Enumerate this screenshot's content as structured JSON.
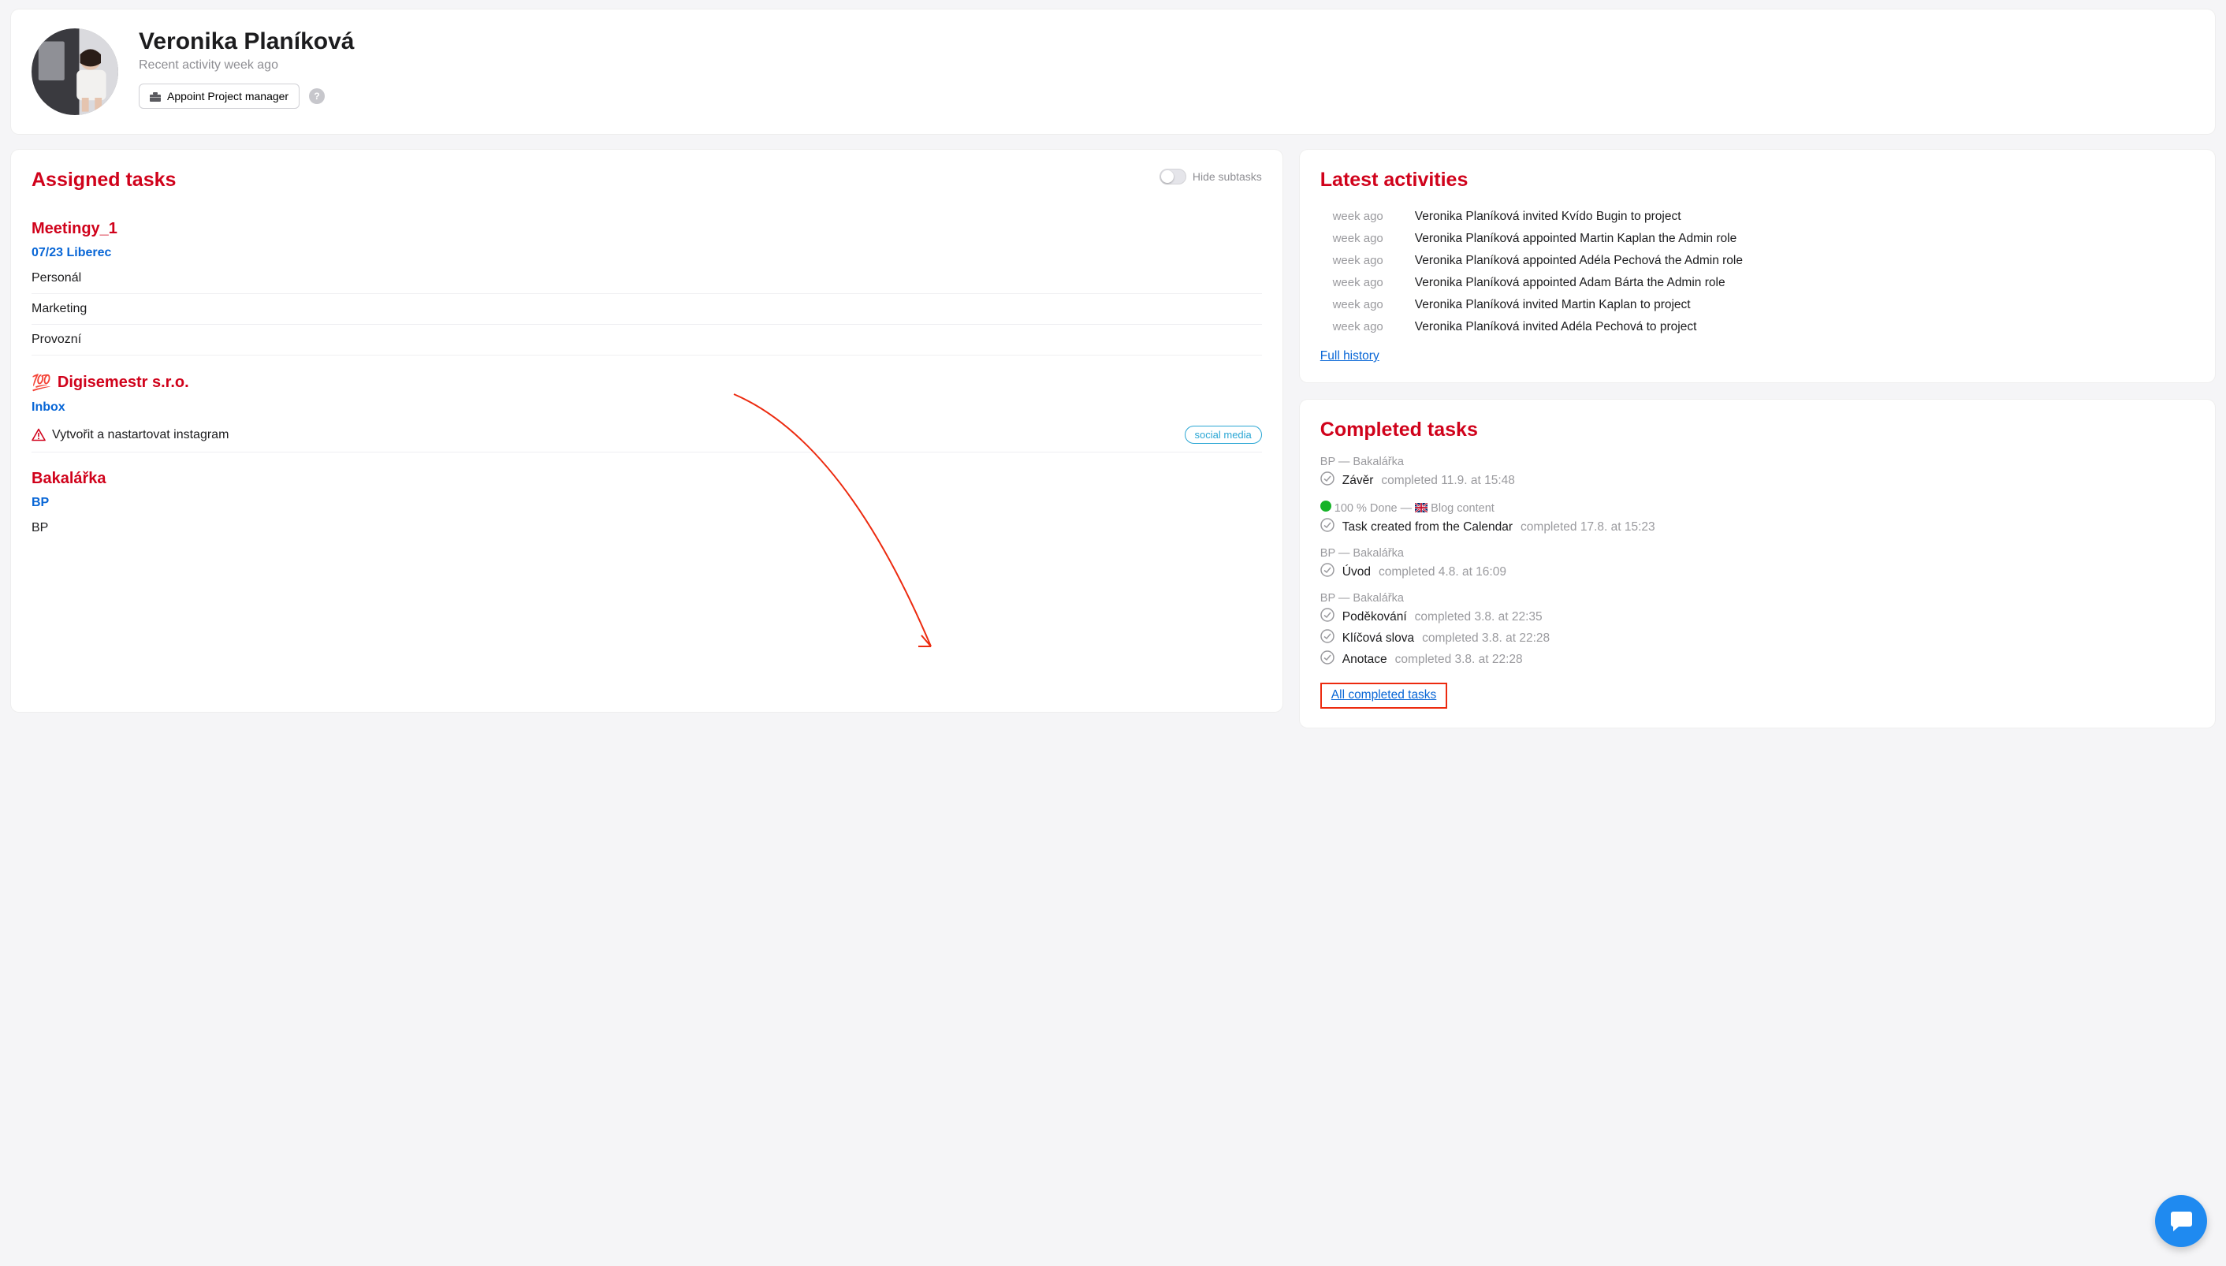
{
  "profile": {
    "name": "Veronika Planíková",
    "recent_activity": "Recent activity week ago",
    "appoint_btn": "Appoint Project manager",
    "help_tooltip": "?"
  },
  "assigned": {
    "title": "Assigned tasks",
    "hide_subtasks_label": "Hide subtasks",
    "projects": [
      {
        "name": "Meetingy_1",
        "emoji": "",
        "stages": [
          {
            "name": "07/23 Liberec",
            "tasks": [
              {
                "name": "Personál",
                "warn": false,
                "tag": ""
              },
              {
                "name": "Marketing",
                "warn": false,
                "tag": ""
              },
              {
                "name": "Provozní",
                "warn": false,
                "tag": ""
              }
            ]
          }
        ]
      },
      {
        "name": "Digisemestr s.r.o.",
        "emoji": "💯",
        "stages": [
          {
            "name": "Inbox",
            "tasks": [
              {
                "name": "Vytvořit a nastartovat instagram",
                "warn": true,
                "tag": "social media"
              }
            ]
          }
        ]
      },
      {
        "name": "Bakalářka",
        "emoji": "",
        "stages": [
          {
            "name": "BP",
            "tasks": [
              {
                "name": "BP",
                "warn": false,
                "tag": ""
              }
            ]
          }
        ]
      }
    ]
  },
  "activities": {
    "title": "Latest activities",
    "rows": [
      {
        "time": "week ago",
        "text": "Veronika Planíková invited Kvído Bugin to project"
      },
      {
        "time": "week ago",
        "text": "Veronika Planíková appointed Martin Kaplan the Admin role"
      },
      {
        "time": "week ago",
        "text": "Veronika Planíková appointed Adéla Pechová the Admin role"
      },
      {
        "time": "week ago",
        "text": "Veronika Planíková appointed Adam Bárta the Admin role"
      },
      {
        "time": "week ago",
        "text": "Veronika Planíková invited Martin Kaplan to project"
      },
      {
        "time": "week ago",
        "text": "Veronika Planíková invited Adéla Pechová to project"
      }
    ],
    "full_history": "Full history"
  },
  "completed": {
    "title": "Completed tasks",
    "groups": [
      {
        "context": "BP — Bakalářka",
        "green_dot": false,
        "flag": false,
        "tasks": [
          {
            "name": "Závěr",
            "meta": "completed 11.9. at 15:48"
          }
        ]
      },
      {
        "context": "100 % Done — 🇬🇧 Blog content",
        "green_dot": true,
        "flag": true,
        "context_plain": "100 % Done — ",
        "context_tail": " Blog content",
        "tasks": [
          {
            "name": "Task created from the Calendar",
            "meta": "completed 17.8. at 15:23"
          }
        ]
      },
      {
        "context": "BP — Bakalářka",
        "green_dot": false,
        "flag": false,
        "tasks": [
          {
            "name": "Úvod",
            "meta": "completed 4.8. at 16:09"
          }
        ]
      },
      {
        "context": "BP — Bakalářka",
        "green_dot": false,
        "flag": false,
        "tasks": [
          {
            "name": "Poděkování",
            "meta": "completed 3.8. at 22:35"
          },
          {
            "name": "Klíčová slova",
            "meta": "completed 3.8. at 22:28"
          },
          {
            "name": "Anotace",
            "meta": "completed 3.8. at 22:28"
          }
        ]
      }
    ],
    "all_link": "All completed tasks"
  }
}
